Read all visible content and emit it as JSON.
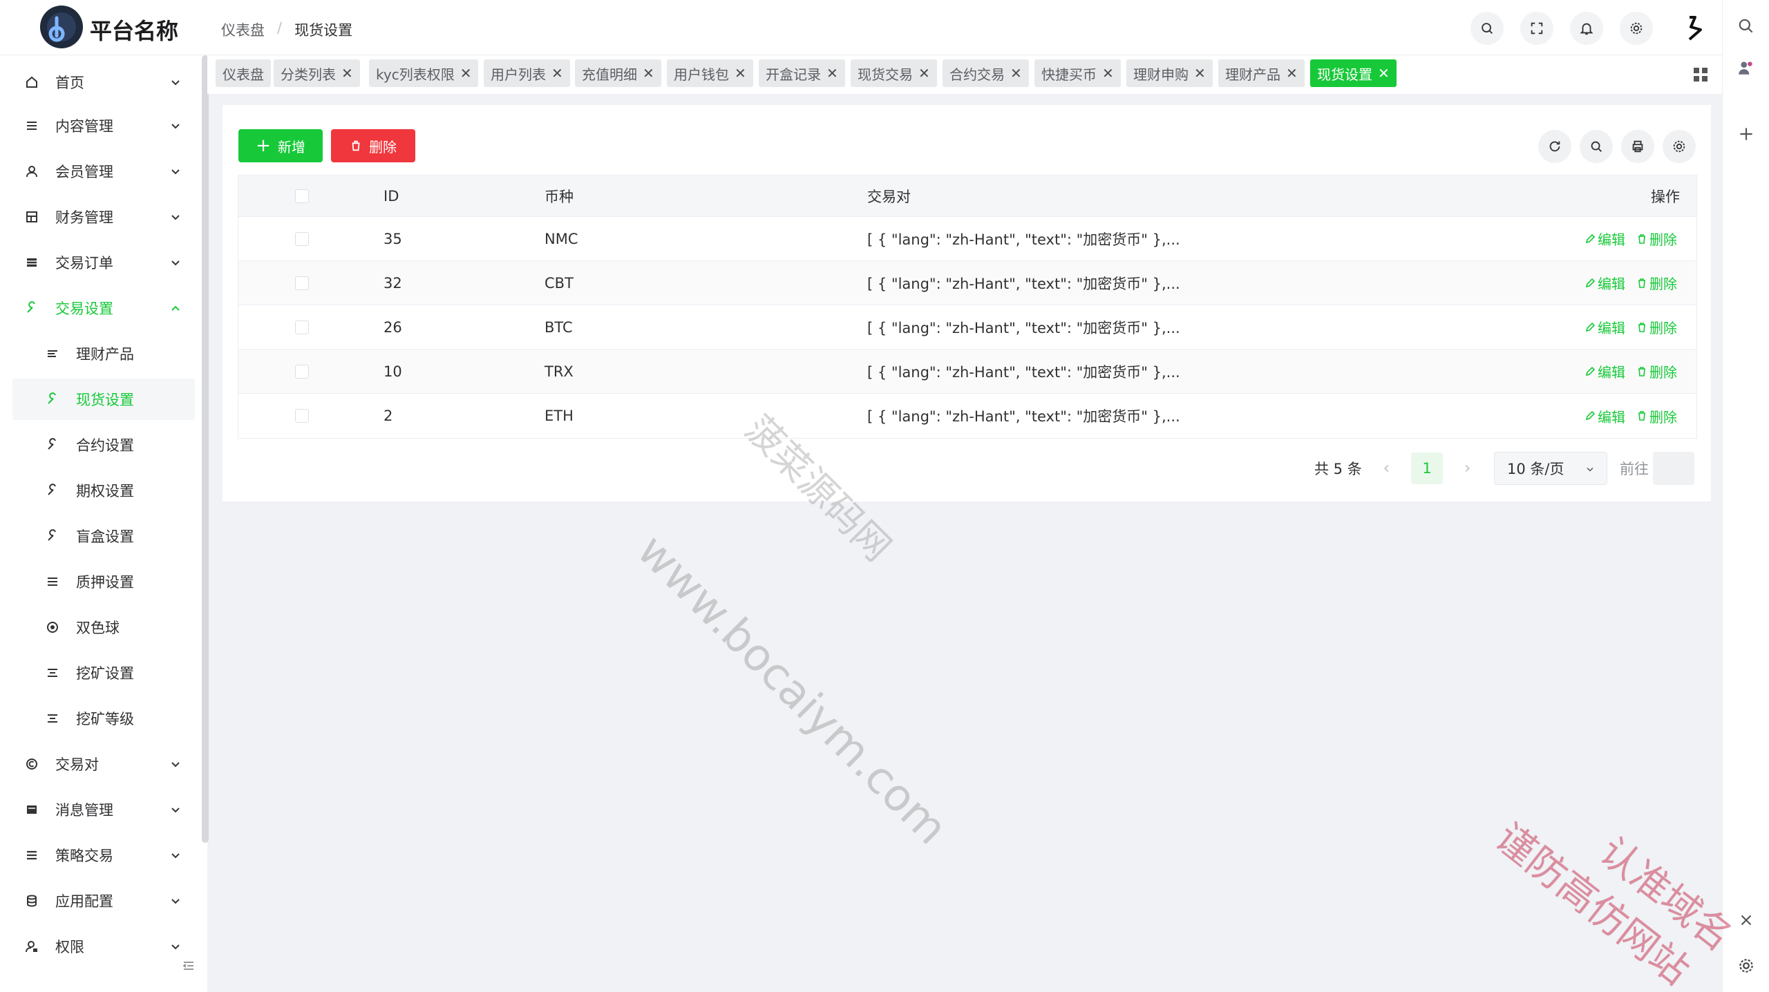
{
  "header": {
    "app_name": "平台名称",
    "breadcrumb": [
      "仪表盘",
      "现货设置"
    ]
  },
  "sidebar": {
    "items": [
      {
        "label": "首页"
      },
      {
        "label": "内容管理"
      },
      {
        "label": "会员管理"
      },
      {
        "label": "财务管理"
      },
      {
        "label": "交易订单"
      },
      {
        "label": "交易设置"
      },
      {
        "label": "理财产品"
      },
      {
        "label": "现货设置"
      },
      {
        "label": "合约设置"
      },
      {
        "label": "期权设置"
      },
      {
        "label": "盲盒设置"
      },
      {
        "label": "质押设置"
      },
      {
        "label": "双色球"
      },
      {
        "label": "挖矿设置"
      },
      {
        "label": "挖矿等级"
      },
      {
        "label": "交易对"
      },
      {
        "label": "消息管理"
      },
      {
        "label": "策略交易"
      },
      {
        "label": "应用配置"
      },
      {
        "label": "权限"
      }
    ]
  },
  "tabs": [
    {
      "label": "仪表盘"
    },
    {
      "label": "分类列表"
    },
    {
      "label": "kyc列表权限"
    },
    {
      "label": "用户列表"
    },
    {
      "label": "充值明细"
    },
    {
      "label": "用户钱包"
    },
    {
      "label": "开盒记录"
    },
    {
      "label": "现货交易"
    },
    {
      "label": "合约交易"
    },
    {
      "label": "快捷买币"
    },
    {
      "label": "理财申购"
    },
    {
      "label": "理财产品"
    },
    {
      "label": "现货设置"
    }
  ],
  "toolbar": {
    "add_label": "新增",
    "delete_label": "删除"
  },
  "table": {
    "columns": [
      "ID",
      "币种",
      "交易对",
      "操作"
    ],
    "rows": [
      {
        "id": "35",
        "coin": "NMC",
        "pair": "[ { \"lang\": \"zh-Hant\", \"text\": \"加密货币\" },..."
      },
      {
        "id": "32",
        "coin": "CBT",
        "pair": "[ { \"lang\": \"zh-Hant\", \"text\": \"加密货币\" },..."
      },
      {
        "id": "26",
        "coin": "BTC",
        "pair": "[ { \"lang\": \"zh-Hant\", \"text\": \"加密货币\" },..."
      },
      {
        "id": "10",
        "coin": "TRX",
        "pair": "[ { \"lang\": \"zh-Hant\", \"text\": \"加密货币\" },..."
      },
      {
        "id": "2",
        "coin": "ETH",
        "pair": "[ { \"lang\": \"zh-Hant\", \"text\": \"加密货币\" },..."
      }
    ],
    "edit_label": "编辑",
    "delete_label": "删除"
  },
  "pagination": {
    "total_text": "共 5 条",
    "current_page": "1",
    "page_size": "10 条/页",
    "goto_label": "前往"
  },
  "watermarks": {
    "line1": "www.bocaiym.com",
    "line2": "菠菜源码网",
    "line3": "谨防高仿网站",
    "line4": "认准域名"
  },
  "colors": {
    "accent": "#17c938",
    "danger": "#f0373d"
  }
}
